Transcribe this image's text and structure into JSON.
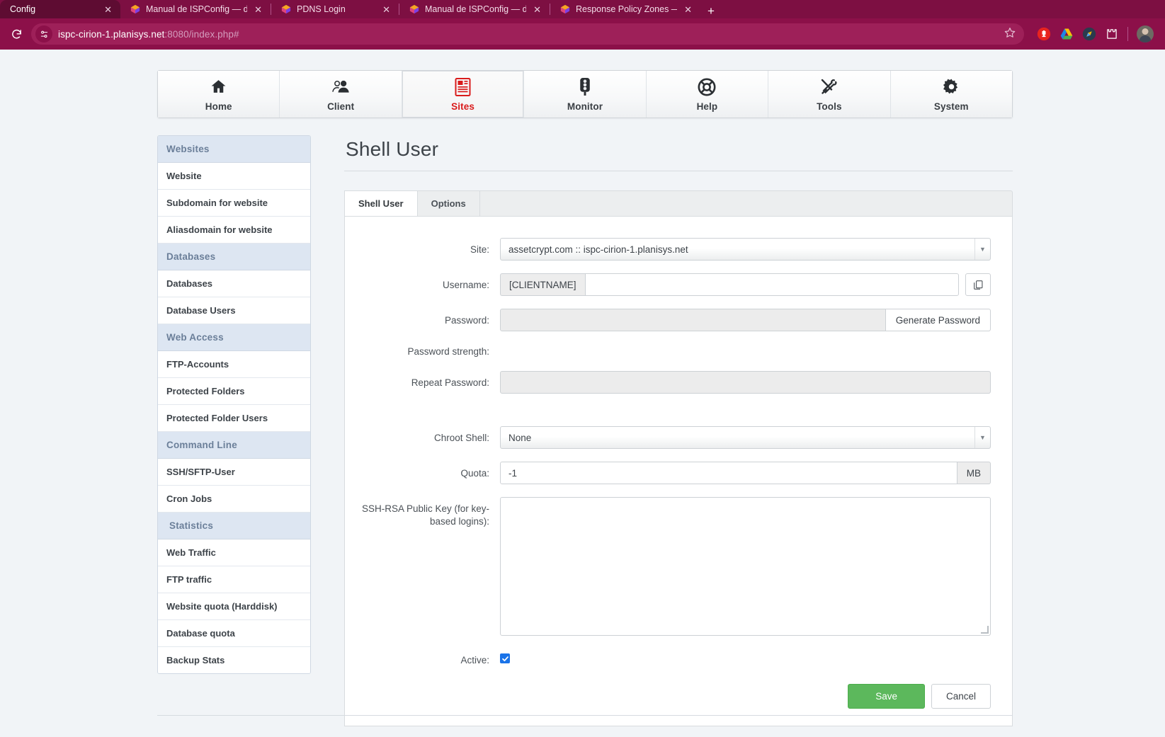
{
  "browser": {
    "tabs": [
      {
        "title": "Config",
        "active": true,
        "favicon": "none"
      },
      {
        "title": "Manual de ISPConfig — docum",
        "active": false,
        "favicon": "ispconfig-cube-icon"
      },
      {
        "title": "PDNS Login",
        "active": false,
        "favicon": "ispconfig-cube-icon"
      },
      {
        "title": "Manual de ISPConfig — docum",
        "active": false,
        "favicon": "ispconfig-cube-icon"
      },
      {
        "title": "Response Policy Zones — docu",
        "active": false,
        "favicon": "ispconfig-cube-icon"
      }
    ],
    "tab_close_label": "✕",
    "new_tab_label": "+",
    "reload_icon": "reload-icon",
    "url_host": "ispc-cirion-1.planisys.net",
    "url_rest": ":8080/index.php#",
    "star_label": "☆",
    "site_info_icon": "site-settings-icon",
    "extensions": [
      "ublock-origin-icon",
      "google-drive-icon",
      "extension-icon",
      "puzzle-extensions-icon"
    ]
  },
  "topnav": {
    "items": [
      {
        "label": "Home",
        "icon": "home-icon",
        "active": false
      },
      {
        "label": "Client",
        "icon": "client-icon",
        "active": false
      },
      {
        "label": "Sites",
        "icon": "sites-icon",
        "active": true
      },
      {
        "label": "Monitor",
        "icon": "monitor-icon",
        "active": false
      },
      {
        "label": "Help",
        "icon": "help-icon",
        "active": false
      },
      {
        "label": "Tools",
        "icon": "tools-icon",
        "active": false
      },
      {
        "label": "System",
        "icon": "system-gear-icon",
        "active": false
      }
    ],
    "active_color": "#d91b1b"
  },
  "sidebar": {
    "groups": [
      {
        "header": "Websites",
        "items": [
          "Website",
          "Subdomain for website",
          "Aliasdomain for website"
        ]
      },
      {
        "header": "Databases",
        "items": [
          "Databases",
          "Database Users"
        ]
      },
      {
        "header": "Web Access",
        "items": [
          "FTP-Accounts",
          "Protected Folders",
          "Protected Folder Users"
        ]
      },
      {
        "header": "Command Line",
        "items": [
          "SSH/SFTP-User",
          "Cron Jobs"
        ]
      },
      {
        "header": "Statistics",
        "items": [
          "Web Traffic",
          "FTP traffic",
          "Website quota (Harddisk)",
          "Database quota",
          "Backup Stats"
        ]
      }
    ]
  },
  "content": {
    "page_title": "Shell User",
    "tabs": [
      {
        "label": "Shell User",
        "active": true
      },
      {
        "label": "Options",
        "active": false
      }
    ],
    "form": {
      "site": {
        "label": "Site:",
        "value": "assetcrypt.com :: ispc-cirion-1.planisys.net",
        "caret": "▼"
      },
      "username": {
        "label": "Username:",
        "prefix": "[CLIENTNAME]",
        "value": "",
        "copy_icon": "copy-icon"
      },
      "password": {
        "label": "Password:",
        "value": "",
        "button": "Generate Password"
      },
      "password_strength": {
        "label": "Password strength:",
        "value": ""
      },
      "repeat_password": {
        "label": "Repeat Password:",
        "value": ""
      },
      "chroot_shell": {
        "label": "Chroot Shell:",
        "value": "None",
        "caret": "▼"
      },
      "quota": {
        "label": "Quota:",
        "value": "-1",
        "unit": "MB"
      },
      "ssh_rsa": {
        "label": "SSH-RSA Public Key (for key-based logins):",
        "value": ""
      },
      "active": {
        "label": "Active:",
        "checked": true,
        "check_glyph": "✓"
      }
    },
    "buttons": {
      "save": "Save",
      "cancel": "Cancel",
      "save_color": "#5cb85c"
    }
  }
}
